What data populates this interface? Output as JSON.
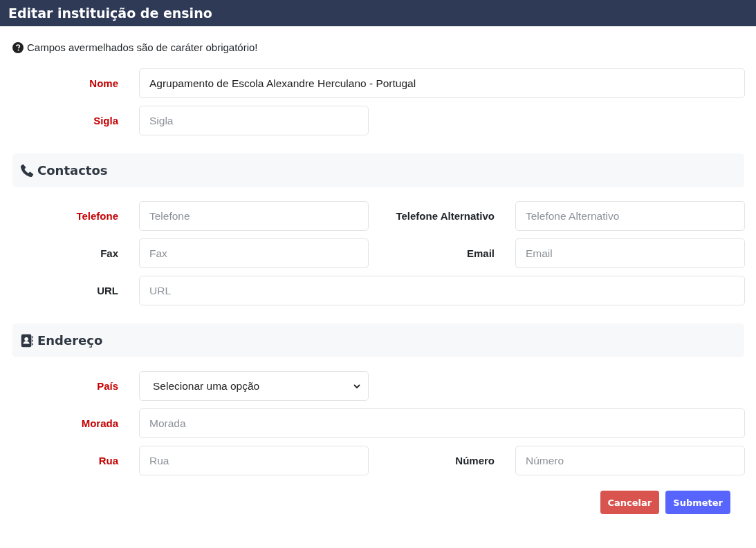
{
  "window": {
    "title": "Editar instituição de ensino"
  },
  "notice": "Campos avermelhados são de caráter obrigatório!",
  "sections": [
    {
      "rows": [
        {
          "fields": [
            {
              "label": "Nome",
              "required": true,
              "kind": "text",
              "wide": true,
              "value": "Agrupamento de Escola Alexandre Herculano - Portugal"
            }
          ]
        },
        {
          "fields": [
            {
              "label": "Sigla",
              "required": true,
              "kind": "text",
              "wide": false,
              "placeholder": "Sigla"
            }
          ]
        }
      ]
    },
    {
      "heading": "Contactos",
      "kind": "contacts",
      "rows": [
        {
          "fields": [
            {
              "label": "Telefone",
              "required": true,
              "kind": "text",
              "wide": false,
              "placeholder": "Telefone"
            },
            {
              "label": "Telefone Alternativo",
              "required": false,
              "kind": "text",
              "wide": false,
              "placeholder": "Telefone Alternativo"
            }
          ]
        },
        {
          "fields": [
            {
              "label": "Fax",
              "required": false,
              "kind": "text",
              "wide": false,
              "placeholder": "Fax"
            },
            {
              "label": "Email",
              "required": false,
              "kind": "text",
              "wide": false,
              "placeholder": "Email"
            }
          ]
        },
        {
          "fields": [
            {
              "label": "URL",
              "required": false,
              "kind": "text",
              "wide": true,
              "placeholder": "URL"
            }
          ]
        }
      ]
    },
    {
      "heading": "Endereço",
      "kind": "address",
      "rows": [
        {
          "fields": [
            {
              "label": "País",
              "required": true,
              "kind": "select",
              "wide": false,
              "value": "Selecionar uma opção"
            }
          ]
        },
        {
          "fields": [
            {
              "label": "Morada",
              "required": true,
              "kind": "text",
              "wide": true,
              "placeholder": "Morada"
            }
          ]
        },
        {
          "fields": [
            {
              "label": "Rua",
              "required": true,
              "kind": "text",
              "wide": false,
              "placeholder": "Rua"
            },
            {
              "label": "Número",
              "required": false,
              "kind": "text",
              "wide": false,
              "placeholder": "Número"
            }
          ]
        }
      ]
    }
  ],
  "buttons": [
    {
      "label": "Cancelar",
      "kind": "danger"
    },
    {
      "label": "Submeter",
      "kind": "primary"
    }
  ]
}
